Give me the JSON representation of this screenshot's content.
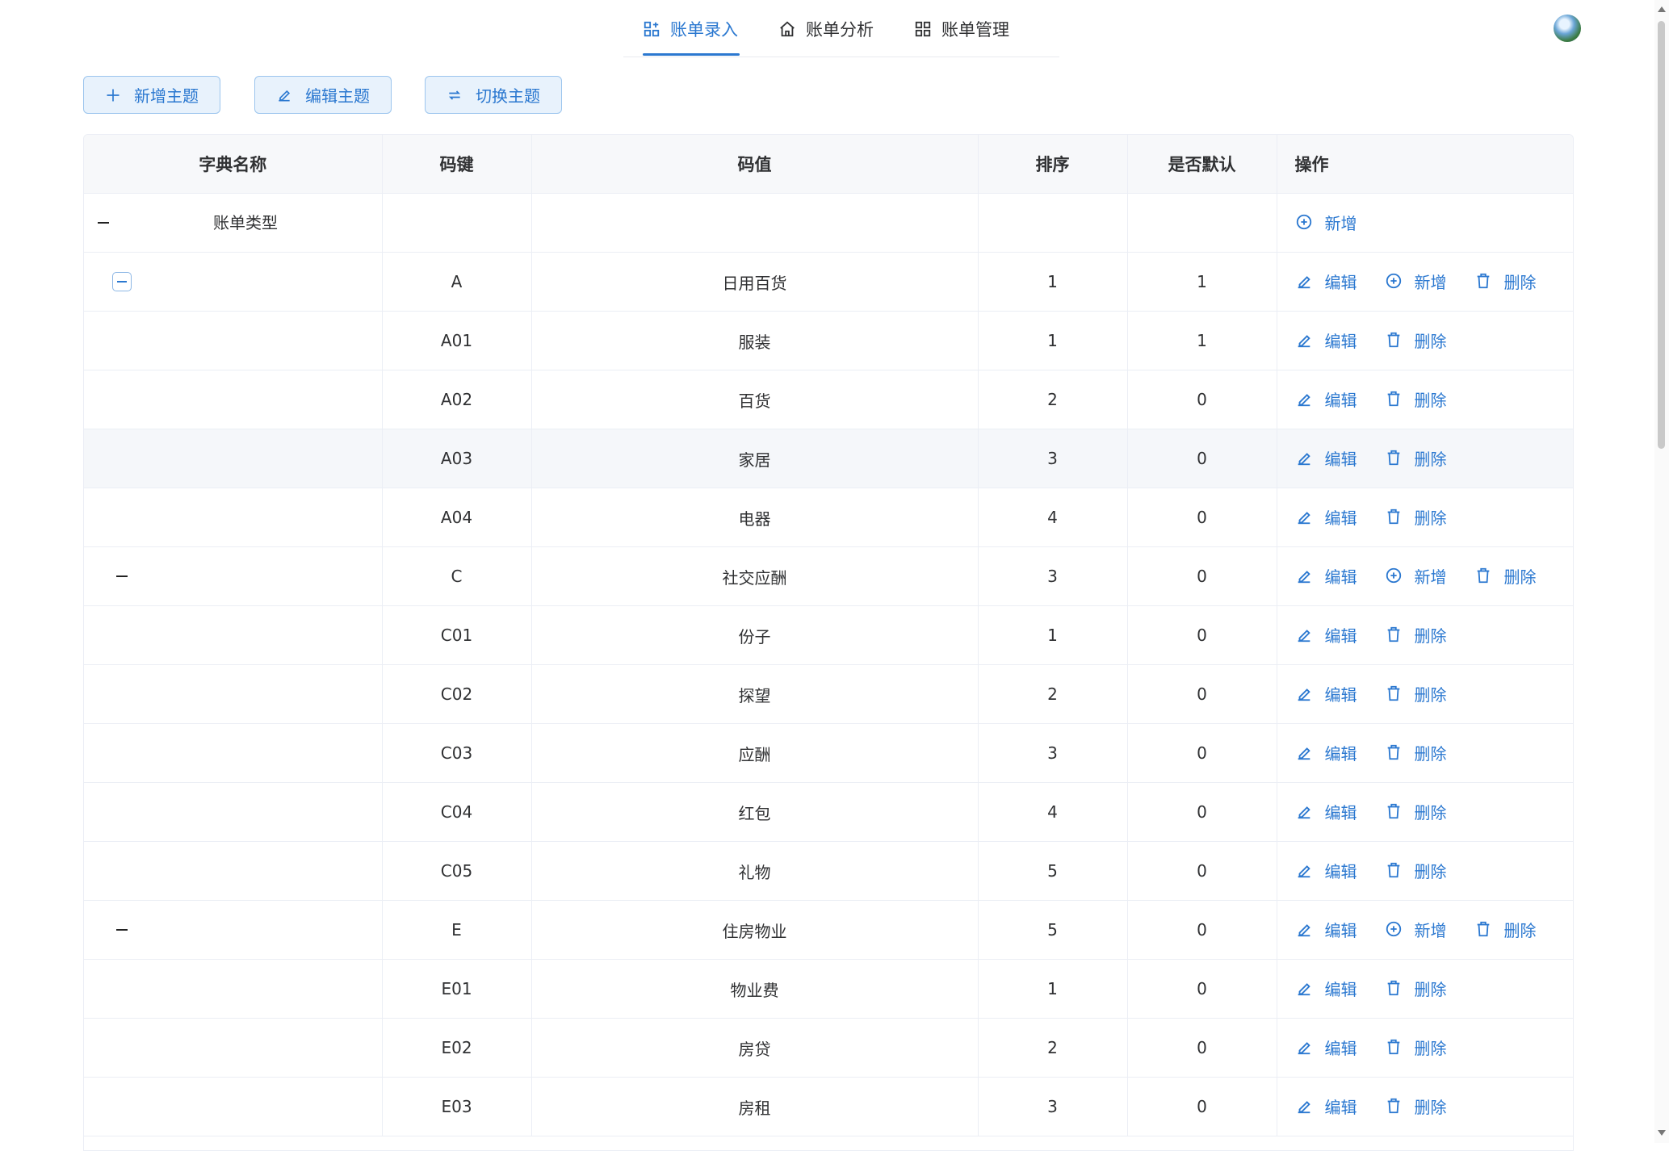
{
  "nav": {
    "tabs": [
      {
        "label": "账单录入",
        "icon": "grid-edit-icon",
        "active": true
      },
      {
        "label": "账单分析",
        "icon": "home-icon",
        "active": false
      },
      {
        "label": "账单管理",
        "icon": "apps-grid-icon",
        "active": false
      }
    ]
  },
  "toolbar": {
    "add_theme": "新增主题",
    "edit_theme": "编辑主题",
    "switch_theme": "切换主题"
  },
  "table": {
    "headers": [
      "字典名称",
      "码键",
      "码值",
      "排序",
      "是否默认",
      "操作"
    ],
    "ops": {
      "edit": "编辑",
      "add": "新增",
      "delete": "删除"
    },
    "rows": [
      {
        "name": "账单类型",
        "key": "",
        "value": "",
        "sort": "",
        "default": "",
        "level": 0,
        "toggle": "minus",
        "ops": [
          "add"
        ]
      },
      {
        "name": "",
        "key": "A",
        "value": "日用百货",
        "sort": "1",
        "default": "1",
        "level": 1,
        "toggle": "minus-boxed",
        "ops": [
          "edit",
          "add",
          "delete"
        ]
      },
      {
        "name": "",
        "key": "A01",
        "value": "服装",
        "sort": "1",
        "default": "1",
        "level": 2,
        "ops": [
          "edit",
          "delete"
        ]
      },
      {
        "name": "",
        "key": "A02",
        "value": "百货",
        "sort": "2",
        "default": "0",
        "level": 2,
        "ops": [
          "edit",
          "delete"
        ]
      },
      {
        "name": "",
        "key": "A03",
        "value": "家居",
        "sort": "3",
        "default": "0",
        "level": 2,
        "ops": [
          "edit",
          "delete"
        ],
        "highlight": true
      },
      {
        "name": "",
        "key": "A04",
        "value": "电器",
        "sort": "4",
        "default": "0",
        "level": 2,
        "ops": [
          "edit",
          "delete"
        ]
      },
      {
        "name": "",
        "key": "C",
        "value": "社交应酬",
        "sort": "3",
        "default": "0",
        "level": 1,
        "toggle": "minus",
        "ops": [
          "edit",
          "add",
          "delete"
        ]
      },
      {
        "name": "",
        "key": "C01",
        "value": "份子",
        "sort": "1",
        "default": "0",
        "level": 2,
        "ops": [
          "edit",
          "delete"
        ]
      },
      {
        "name": "",
        "key": "C02",
        "value": "探望",
        "sort": "2",
        "default": "0",
        "level": 2,
        "ops": [
          "edit",
          "delete"
        ]
      },
      {
        "name": "",
        "key": "C03",
        "value": "应酬",
        "sort": "3",
        "default": "0",
        "level": 2,
        "ops": [
          "edit",
          "delete"
        ]
      },
      {
        "name": "",
        "key": "C04",
        "value": "红包",
        "sort": "4",
        "default": "0",
        "level": 2,
        "ops": [
          "edit",
          "delete"
        ]
      },
      {
        "name": "",
        "key": "C05",
        "value": "礼物",
        "sort": "5",
        "default": "0",
        "level": 2,
        "ops": [
          "edit",
          "delete"
        ]
      },
      {
        "name": "",
        "key": "E",
        "value": "住房物业",
        "sort": "5",
        "default": "0",
        "level": 1,
        "toggle": "minus",
        "ops": [
          "edit",
          "add",
          "delete"
        ]
      },
      {
        "name": "",
        "key": "E01",
        "value": "物业费",
        "sort": "1",
        "default": "0",
        "level": 2,
        "ops": [
          "edit",
          "delete"
        ]
      },
      {
        "name": "",
        "key": "E02",
        "value": "房贷",
        "sort": "2",
        "default": "0",
        "level": 2,
        "ops": [
          "edit",
          "delete"
        ]
      },
      {
        "name": "",
        "key": "E03",
        "value": "房租",
        "sort": "3",
        "default": "0",
        "level": 2,
        "ops": [
          "edit",
          "delete"
        ]
      }
    ]
  },
  "colors": {
    "accent": "#2b78d0",
    "header_bg": "#f7f8fa",
    "border": "#ebeef5",
    "button_bg": "#e8f2fc"
  }
}
